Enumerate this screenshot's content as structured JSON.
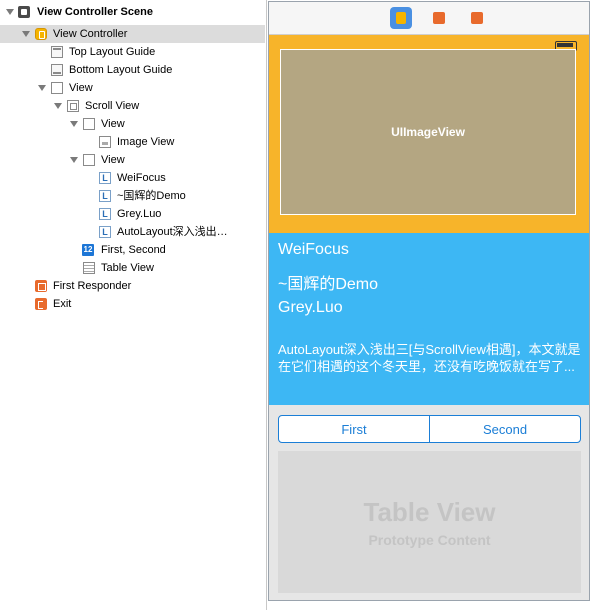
{
  "outline": {
    "items": [
      {
        "label": "View Controller Scene"
      },
      {
        "label": "View Controller"
      },
      {
        "label": "Top Layout Guide"
      },
      {
        "label": "Bottom Layout Guide"
      },
      {
        "label": "View"
      },
      {
        "label": "Scroll View"
      },
      {
        "label": "View"
      },
      {
        "label": "Image View"
      },
      {
        "label": "View"
      },
      {
        "label": "WeiFocus"
      },
      {
        "label": "~国辉的Demo"
      },
      {
        "label": "Grey.Luo"
      },
      {
        "label": "AutoLayout深入浅出…"
      },
      {
        "label": "First, Second"
      },
      {
        "label": "Table View"
      },
      {
        "label": "First Responder"
      },
      {
        "label": "Exit"
      }
    ],
    "label_icon_glyph": "L",
    "segment_icon_glyph": "12"
  },
  "scene": {
    "imageview_label": "UIImageView",
    "labels": {
      "weifocus": "WeiFocus",
      "demo": "~国辉的Demo",
      "grey": "Grey.Luo",
      "paragraph": "AutoLayout深入浅出三[与ScrollView相遇]，本文就是在它们相遇的这个冬天里，还没有吃晚饭就在写了..."
    },
    "segmented": {
      "first": "First",
      "second": "Second"
    },
    "tableview": {
      "title": "Table View",
      "subtitle": "Prototype Content"
    }
  },
  "colors": {
    "orange": "#f7b42a",
    "image_bg": "#b4a682",
    "blue": "#3db7f4",
    "tint": "#1b7ed6",
    "selected_row": "#dcdcdc"
  },
  "icons": [
    "scene-icon",
    "view-controller-icon",
    "layout-guide-icon",
    "view-icon",
    "scroll-view-icon",
    "image-view-icon",
    "label-icon",
    "segmented-control-icon",
    "table-view-icon",
    "first-responder-icon",
    "exit-icon",
    "battery-icon"
  ]
}
